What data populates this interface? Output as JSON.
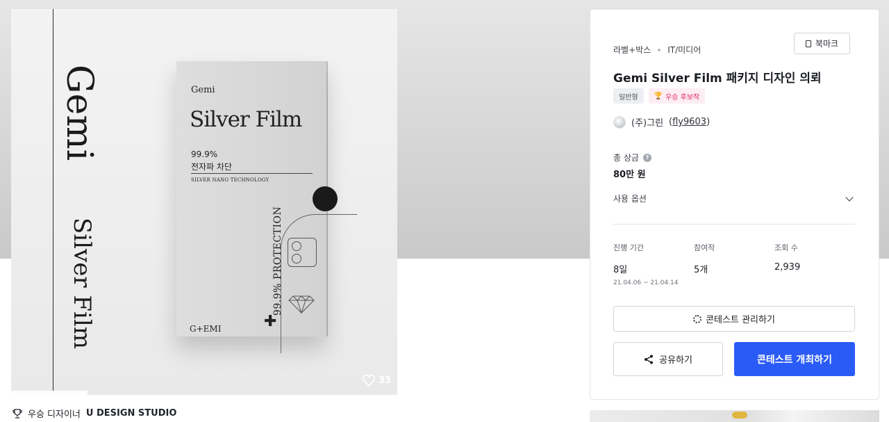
{
  "artwork": {
    "side_vertical_1": "Gemi",
    "side_vertical_2": "Silver Film",
    "box": {
      "brand": "Gemi",
      "title": "Silver Film",
      "percent": "99.9%",
      "korean": "전자파 차단",
      "tech": "SILVER NANO TECHNOLOGY",
      "protection": "99.9% PROTECTION",
      "plus": "✚",
      "logo": "G+EMI"
    },
    "likes": "33"
  },
  "caption": {
    "label": "우승 디자이너",
    "designer": "U DESIGN STUDIO"
  },
  "panel": {
    "breadcrumb": [
      "라벨+박스",
      "IT/미디어"
    ],
    "bookmark_label": "북마크",
    "title": "Gemi Silver Film 패키지 디자인 의뢰",
    "badge_type": "일반형",
    "badge_winner": "우승 후보작",
    "owner_name": "(주)그린",
    "owner_handle": "fly9603",
    "prize_label": "총 상금",
    "prize_value": "80만 원",
    "options_label": "사용 옵션",
    "stats": {
      "period_label": "진행 기간",
      "period_value": "8일",
      "period_range": "21.04.06 ~ 21.04.14",
      "participants_label": "참여작",
      "participants_value": "5개",
      "views_label": "조회 수",
      "views_value": "2,939"
    },
    "manage_button": "콘테스트 관리하기",
    "share_button": "공유하기",
    "host_button": "콘테스트 개최하기"
  },
  "colors": {
    "primary": "#2a5bf6",
    "winner_badge": "#e0245e"
  }
}
